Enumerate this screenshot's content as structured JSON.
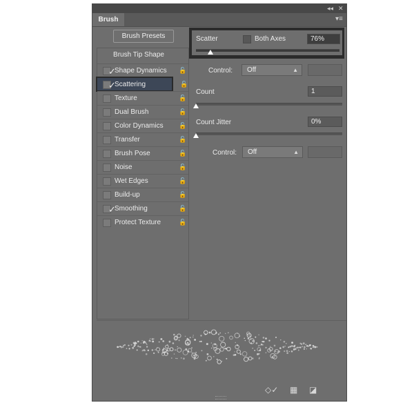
{
  "panel": {
    "tab_title": "Brush",
    "collapse_glyph": "◂◂",
    "close_glyph": "✕",
    "menu_glyph": "▾≡"
  },
  "left": {
    "presets_button": "Brush Presets",
    "tip_shape_label": "Brush Tip Shape",
    "items": [
      {
        "label": "Shape Dynamics",
        "checked": true
      },
      {
        "label": "Scattering",
        "checked": true,
        "selected": true
      },
      {
        "label": "Texture",
        "checked": false
      },
      {
        "label": "Dual Brush",
        "checked": false
      },
      {
        "label": "Color Dynamics",
        "checked": false
      },
      {
        "label": "Transfer",
        "checked": false
      },
      {
        "label": "Brush Pose",
        "checked": false
      },
      {
        "label": "Noise",
        "checked": false
      },
      {
        "label": "Wet Edges",
        "checked": false
      },
      {
        "label": "Build-up",
        "checked": false
      },
      {
        "label": "Smoothing",
        "checked": true
      },
      {
        "label": "Protect Texture",
        "checked": false
      }
    ]
  },
  "right": {
    "scatter_label": "Scatter",
    "both_axes_label": "Both Axes",
    "scatter_value": "76%",
    "scatter_fraction": 0.1,
    "control1_label": "Control:",
    "control1_value": "Off",
    "count_label": "Count",
    "count_value": "1",
    "count_fraction": 0.0,
    "count_jitter_label": "Count Jitter",
    "count_jitter_value": "0%",
    "count_jitter_fraction": 0.0,
    "control2_label": "Control:",
    "control2_value": "Off"
  },
  "footer": {
    "toggle_glyph": "◇✓",
    "grid_glyph": "▦",
    "new_glyph": "◪"
  },
  "colors": {
    "panel_bg": "#6e6e6e",
    "selected_bg": "#3d4757",
    "highlight_box": "#2b2b2b"
  }
}
